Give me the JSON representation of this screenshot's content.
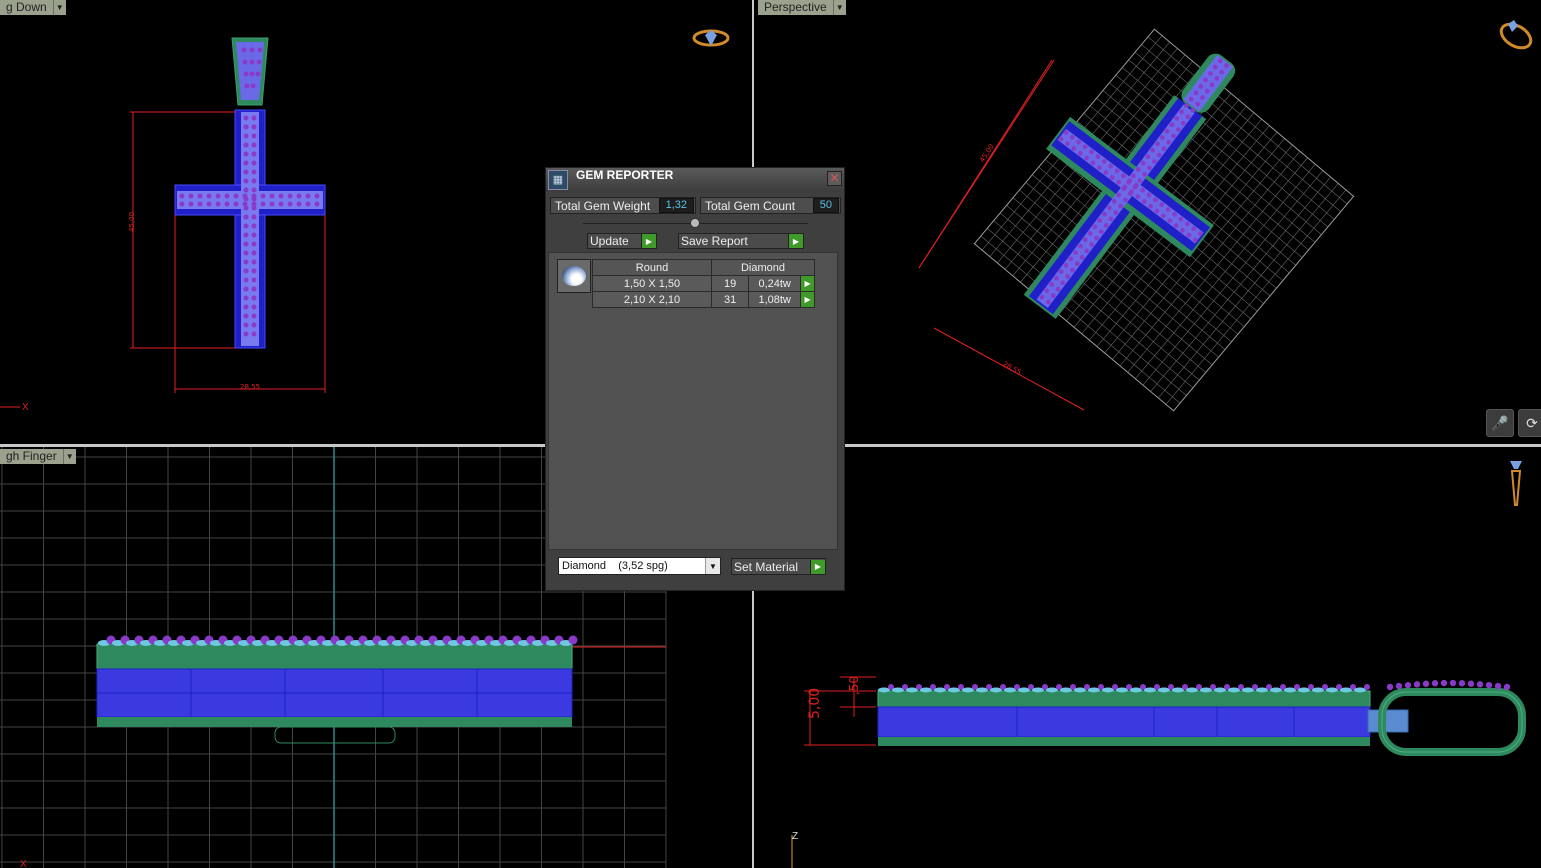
{
  "viewports": {
    "top_left": {
      "label": "g Down"
    },
    "top_right": {
      "label": "Perspective"
    },
    "bottom_left": {
      "label": "gh Finger"
    }
  },
  "dimensions": {
    "front_height": "45,00",
    "front_width": "28,55",
    "persp_height": "45,00",
    "persp_width": "28,55",
    "side_total": "5,00",
    "side_part": ",50"
  },
  "axis_labels": {
    "x": "X",
    "z": "Z"
  },
  "icons": {
    "ring_top_left": "ring-icon",
    "ring_top_right": "ring-icon",
    "pendant_bottom_right": "pendant-icon",
    "mic": "microphone-icon",
    "rotate": "rotate-icon"
  },
  "gem_reporter": {
    "title": "GEM REPORTER",
    "total_weight_label": "Total Gem Weight",
    "total_weight_value": "1,32",
    "total_count_label": "Total Gem Count",
    "total_count_value": "50",
    "update_label": "Update",
    "save_report_label": "Save Report",
    "table": {
      "headers": [
        "Round",
        "Diamond"
      ],
      "rows": [
        {
          "size": "1,50 X 1,50",
          "count": "19",
          "weight": "0,24tw"
        },
        {
          "size": "2,10 X 2,10",
          "count": "31",
          "weight": "1,08tw"
        }
      ]
    },
    "material_select": "Diamond    (3,52 spg)",
    "set_material_label": "Set Material"
  },
  "colors": {
    "dimension_red": "#e02020",
    "metal_blue": "#3a3ae0",
    "metal_green": "#2e8a5e",
    "gem_purple": "#8a3ac8",
    "gem_cyan": "#6ec8e0",
    "value_text": "#59c3e6",
    "go_green": "#3f9a2a"
  }
}
